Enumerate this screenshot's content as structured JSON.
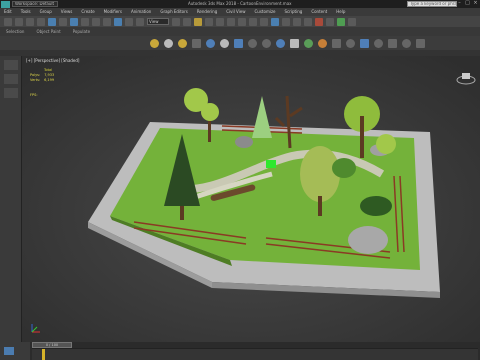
{
  "window": {
    "workspace_label": "Workspace: Default",
    "title": "Autodesk 3ds Max 2018 - CartoonEnvironment.max",
    "search_placeholder": "Type a keyword or phrase"
  },
  "menu": {
    "items": [
      "Edit",
      "Tools",
      "Group",
      "Views",
      "Create",
      "Modifiers",
      "Animation",
      "Graph Editors",
      "Rendering",
      "Civil View",
      "Customize",
      "Scripting",
      "Content",
      "Help"
    ]
  },
  "toolbar": {
    "view_select": "View"
  },
  "ribbon": {
    "tabs": [
      "Selection",
      "Object Paint",
      "Populate"
    ]
  },
  "viewport": {
    "label": "[+] [Perspective] [Shaded]",
    "stats_header": "Total",
    "stats": [
      {
        "label": "Polys:",
        "value": "7,933"
      },
      {
        "label": "Verts:",
        "value": "6,199"
      }
    ],
    "fps_label": "FPS:"
  },
  "timeline": {
    "current": "0 / 100",
    "ticks": [
      "0",
      "5",
      "10",
      "15",
      "20",
      "25",
      "30",
      "35",
      "40",
      "45",
      "50",
      "55",
      "60",
      "65",
      "70",
      "75",
      "80",
      "85",
      "90",
      "95",
      "100"
    ]
  },
  "colors": {
    "grass": "#74b23a",
    "path": "#c9c9b4",
    "border": "#bdbdbd",
    "fence": "#8a3a24",
    "trunk": "#5c3a22",
    "tree_dark": "#2b4a23",
    "tree_light": "#a2c84a"
  }
}
